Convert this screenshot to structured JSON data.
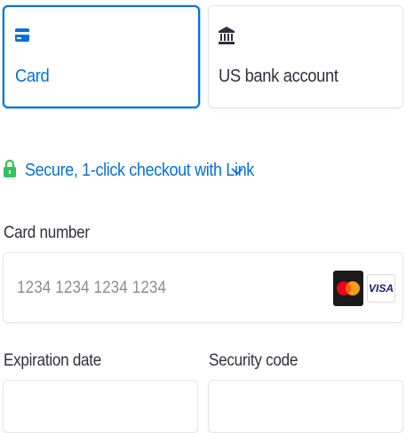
{
  "payment_methods": {
    "card": {
      "label": "Card",
      "icon": "card-icon",
      "selected": true
    },
    "bank": {
      "label": "US bank account",
      "icon": "bank-icon",
      "selected": false
    }
  },
  "link": {
    "text": "Secure, 1-click checkout with Link",
    "icon": "lock-icon",
    "chevron": "chevron-down-icon",
    "color": "#0570de",
    "lock_color": "#33c25b"
  },
  "card_number": {
    "label": "Card number",
    "placeholder": "1234 1234 1234 1234",
    "value": "",
    "brands": [
      "mastercard",
      "visa"
    ],
    "visa_text": "VISA"
  },
  "expiration": {
    "label": "Expiration date",
    "value": ""
  },
  "security_code": {
    "label": "Security code",
    "value": ""
  },
  "colors": {
    "accent": "#0570de",
    "text": "#30313d",
    "placeholder": "#8b8d97",
    "border": "#e6e6e6"
  }
}
